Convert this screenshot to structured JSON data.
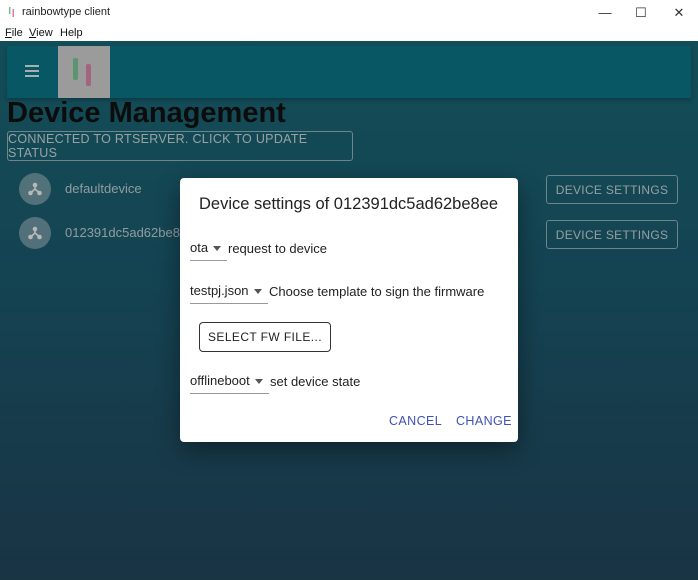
{
  "window": {
    "title": "rainbowtype client",
    "controls": {
      "minimize": "—",
      "maximize": "☐",
      "close": "✕"
    }
  },
  "menubar": {
    "items": [
      {
        "label": "File",
        "hotkey": "F"
      },
      {
        "label": "View",
        "hotkey": "V"
      },
      {
        "label": "Help",
        "hotkey": ""
      }
    ]
  },
  "appbar": {
    "menu_icon": "hamburger-icon",
    "logo": "app-logo"
  },
  "page": {
    "title": "Device Management",
    "status_button": "CONNECTED TO RTSERVER. CLICK TO UPDATE STATUS"
  },
  "devices": [
    {
      "name": "defaultdevice",
      "button": "DEVICE SETTINGS",
      "icon": "device-hub-icon"
    },
    {
      "name": "012391dc5ad62be8",
      "button": "DEVICE SETTINGS",
      "icon": "device-hub-icon"
    }
  ],
  "dialog": {
    "title": "Device settings of 012391dc5ad62be8ee",
    "request": {
      "value": "ota",
      "help": "request to device"
    },
    "template": {
      "value": "testpj.json",
      "help": "Choose template to sign the firmware"
    },
    "fw_button": "SELECT FW FILE...",
    "state": {
      "value": "offlineboot",
      "help": "set device state"
    },
    "cancel": "CANCEL",
    "change": "CHANGE"
  },
  "colors": {
    "appbar": "#0a7b8b",
    "background_top": "#1a6c7a",
    "background_bottom": "#23485e",
    "dialog_action": "#3f51b5"
  }
}
